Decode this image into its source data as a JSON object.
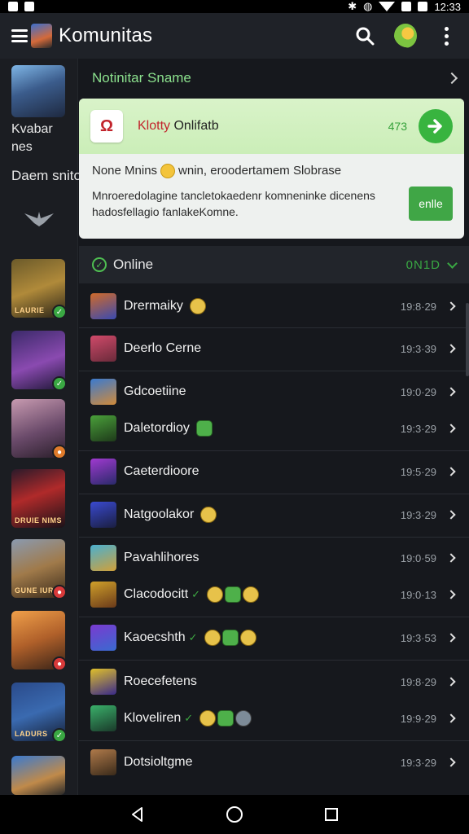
{
  "status_bar": {
    "time": "12:33"
  },
  "app_bar": {
    "title": "Komunitas"
  },
  "sidebar": {
    "profile_name": "Kvabar nes",
    "section_label": "Daem snito",
    "games": [
      {
        "caption": "LAURIE",
        "badge": "check",
        "badge_color": "#3aa843"
      },
      {
        "caption": "",
        "badge": "check",
        "badge_color": "#3aa843"
      },
      {
        "caption": "",
        "badge": "dot",
        "badge_color": "#e07b2b"
      },
      {
        "caption": "DRUIE NIMS",
        "badge": "",
        "badge_color": ""
      },
      {
        "caption": "GUNE IURDS",
        "badge": "dot",
        "badge_color": "#d83a3a"
      },
      {
        "caption": "",
        "badge": "dot",
        "badge_color": "#d83a3a"
      },
      {
        "caption": "LADURS",
        "badge": "check",
        "badge_color": "#3aa843"
      },
      {
        "caption": "",
        "badge": "",
        "badge_color": ""
      }
    ]
  },
  "notifications": {
    "header": "Notinitar Sname",
    "card": {
      "title_red": "Klotty",
      "title_rest": " Onlifatb",
      "count": "473",
      "line1_a": "None Mnins",
      "line1_b": "wnin, eroodertamem Slobrase",
      "description": "Mnroeredolagine tancletokaedenr komneninke dicenens hadosfellagio fanlakeKomne.",
      "button_label": "enlle"
    }
  },
  "online": {
    "label": "Online",
    "count": "0N1D"
  },
  "contacts": [
    {
      "name": "Drermaiky",
      "time": "19:8·29",
      "emojis": [
        "y"
      ],
      "verified": false
    },
    {
      "name": "Deerlo Cerne",
      "time": "19:3·39",
      "emojis": [],
      "verified": false
    },
    {
      "name": "Gdcoetiine",
      "time": "19:0·29",
      "emojis": [],
      "verified": false
    },
    {
      "name": "Daletordioy",
      "time": "19:3·29",
      "emojis": [
        "g"
      ],
      "verified": false
    },
    {
      "name": "Caeterdioore",
      "time": "19:5·29",
      "emojis": [],
      "verified": false
    },
    {
      "name": "Natgoolakor",
      "time": "19:3·29",
      "emojis": [
        "y"
      ],
      "verified": false
    },
    {
      "name": "Pavahlihores",
      "time": "19:0·59",
      "emojis": [],
      "verified": false
    },
    {
      "name": "Clacodocitt",
      "time": "19:0·13",
      "emojis": [
        "y",
        "g",
        "y"
      ],
      "verified": true
    },
    {
      "name": "Kaoecshth",
      "time": "19:3·53",
      "emojis": [
        "y",
        "g",
        "y"
      ],
      "verified": true
    },
    {
      "name": "Roecefetens",
      "time": "19:8·29",
      "emojis": [],
      "verified": false
    },
    {
      "name": "Kloveliren",
      "time": "19:9·29",
      "emojis": [
        "y",
        "g",
        "gr"
      ],
      "verified": true
    },
    {
      "name": "Dotsioltgme",
      "time": "19:3·29",
      "emojis": [],
      "verified": false
    }
  ]
}
